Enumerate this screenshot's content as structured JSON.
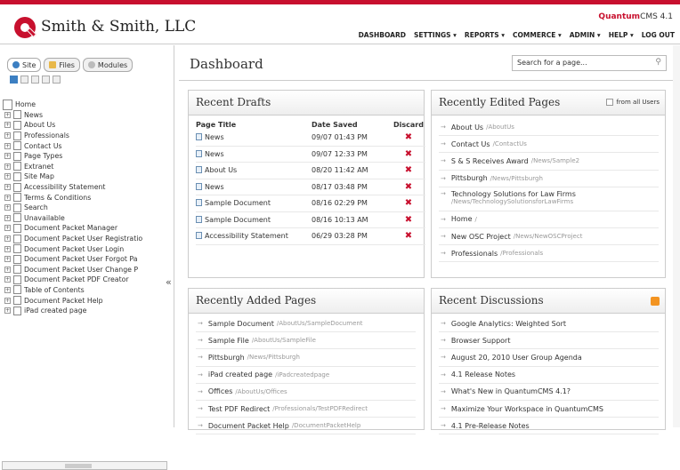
{
  "header": {
    "company": "Smith & Smith, LLC",
    "product_q": "Quantum",
    "product_rest": "CMS 4.1",
    "nav": [
      "DASHBOARD",
      "SETTINGS ▾",
      "REPORTS ▾",
      "COMMERCE ▾",
      "ADMIN ▾",
      "HELP ▾",
      "LOG OUT"
    ]
  },
  "sidebar": {
    "tabs": [
      "Site",
      "Files",
      "Modules"
    ],
    "collapse_glyph": "«",
    "tree": [
      {
        "label": "Home",
        "root": true
      },
      {
        "label": "News"
      },
      {
        "label": "About Us"
      },
      {
        "label": "Professionals"
      },
      {
        "label": "Contact Us"
      },
      {
        "label": "Page Types"
      },
      {
        "label": "Extranet"
      },
      {
        "label": "Site Map"
      },
      {
        "label": "Accessibility Statement"
      },
      {
        "label": "Terms & Conditions"
      },
      {
        "label": "Search"
      },
      {
        "label": "Unavailable"
      },
      {
        "label": "Document Packet Manager"
      },
      {
        "label": "Document Packet User Registratio"
      },
      {
        "label": "Document Packet User Login"
      },
      {
        "label": "Document Packet User Forgot Pa"
      },
      {
        "label": "Document Packet User Change P"
      },
      {
        "label": "Document Packet PDF Creator"
      },
      {
        "label": "Table of Contents"
      },
      {
        "label": "Document Packet Help"
      },
      {
        "label": "iPad created page"
      }
    ]
  },
  "main": {
    "title": "Dashboard",
    "search_placeholder": "Search for a page...",
    "drafts": {
      "title": "Recent Drafts",
      "headers": [
        "Page Title",
        "Date Saved",
        "Discard"
      ],
      "rows": [
        {
          "title": "News",
          "date": "09/07 01:43 PM"
        },
        {
          "title": "News",
          "date": "09/07 12:33 PM"
        },
        {
          "title": "About Us",
          "date": "08/20 11:42 AM"
        },
        {
          "title": "News",
          "date": "08/17 03:48 PM"
        },
        {
          "title": "Sample Document",
          "date": "08/16 02:29 PM"
        },
        {
          "title": "Sample Document",
          "date": "08/16 10:13 AM"
        },
        {
          "title": "Accessibility Statement",
          "date": "06/29 03:28 PM"
        }
      ],
      "discard_glyph": "✖"
    },
    "edited": {
      "title": "Recently Edited Pages",
      "from_all": "from all Users",
      "items": [
        {
          "label": "About Us",
          "path": "/AboutUs"
        },
        {
          "label": "Contact Us",
          "path": "/ContactUs"
        },
        {
          "label": "S & S Receives Award",
          "path": "/News/Sample2"
        },
        {
          "label": "Pittsburgh",
          "path": "/News/Pittsburgh"
        },
        {
          "label": "Technology Solutions for Law Firms",
          "path": "/News/TechnologySolutionsforLawFirms",
          "wrap": true
        },
        {
          "label": "Home",
          "path": "/"
        },
        {
          "label": "New OSC Project",
          "path": "/News/NewOSCProject"
        },
        {
          "label": "Professionals",
          "path": "/Professionals"
        }
      ]
    },
    "added": {
      "title": "Recently Added Pages",
      "items": [
        {
          "label": "Sample Document",
          "path": "/AboutUs/SampleDocument"
        },
        {
          "label": "Sample File",
          "path": "/AboutUs/SampleFile"
        },
        {
          "label": "Pittsburgh",
          "path": "/News/Pittsburgh"
        },
        {
          "label": "iPad created page",
          "path": "/iPadcreatedpage"
        },
        {
          "label": "Offices",
          "path": "/AboutUs/Offices"
        },
        {
          "label": "Test PDF Redirect",
          "path": "/Professionals/TestPDFRedirect"
        },
        {
          "label": "Document Packet Help",
          "path": "/DocumentPacketHelp"
        }
      ]
    },
    "discussions": {
      "title": "Recent Discussions",
      "items": [
        "Google Analytics: Weighted Sort",
        "Browser Support",
        "August 20, 2010 User Group Agenda",
        "4.1 Release Notes",
        "What's New in QuantumCMS 4.1?",
        "Maximize Your Workspace in QuantumCMS",
        "4.1 Pre-Release Notes"
      ]
    }
  },
  "colors": {
    "brand_red": "#c8102e",
    "rss_orange": "#f39421"
  }
}
